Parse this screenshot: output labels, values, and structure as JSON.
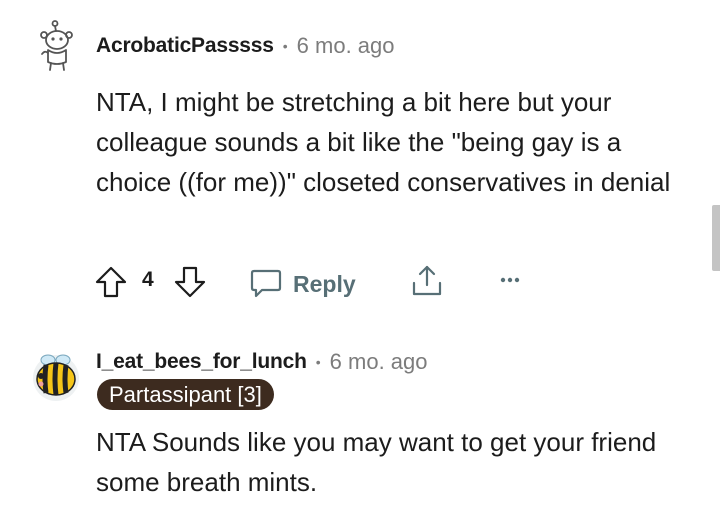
{
  "comments": [
    {
      "username": "AcrobaticPasssss",
      "separator": "•",
      "time": "6 mo. ago",
      "body": "NTA, I might be stretching a bit here but your colleague sounds a bit like the \"being gay is a choice ((for me))\" closeted conservatives in denial",
      "score": "4",
      "reply_label": "Reply",
      "avatar_icon": "snoo-avatar-icon"
    },
    {
      "username": "I_eat_bees_for_lunch",
      "separator": "•",
      "time": "6 mo. ago",
      "flair": "Partassipant [3]",
      "body": "NTA Sounds like you may want to get your friend some breath mints.",
      "avatar_icon": "bee-avatar-icon"
    }
  ],
  "colors": {
    "text": "#1c1c1c",
    "muted": "#7c7c7c",
    "action": "#576f76",
    "flair_bg": "#3d2b1f",
    "flair_text": "#ffffff"
  }
}
